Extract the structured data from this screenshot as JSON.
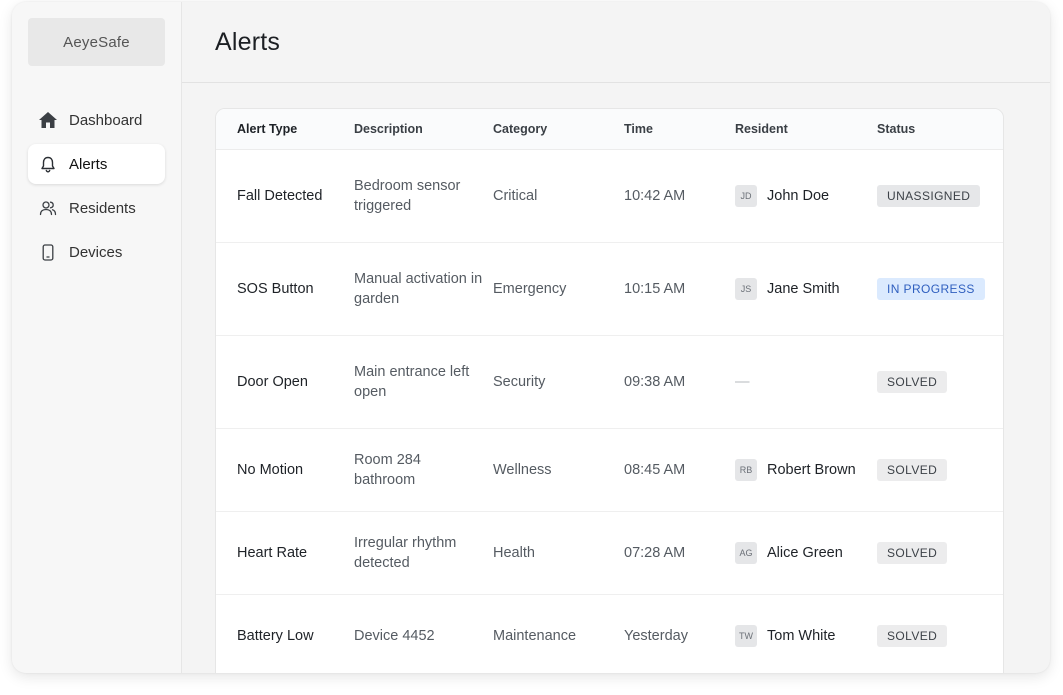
{
  "app": {
    "logo": "AeyeSafe"
  },
  "sidebar": {
    "items": [
      {
        "label": "Dashboard",
        "icon": "home-icon",
        "active": false
      },
      {
        "label": "Alerts",
        "icon": "bell-icon",
        "active": true
      },
      {
        "label": "Residents",
        "icon": "users-icon",
        "active": false
      },
      {
        "label": "Devices",
        "icon": "phone-icon",
        "active": false
      }
    ]
  },
  "header": {
    "title": "Alerts"
  },
  "table": {
    "columns": [
      "Alert Type",
      "Description",
      "Category",
      "Time",
      "Resident",
      "Status"
    ],
    "rows": [
      {
        "type": "Fall Detected",
        "description": "Bedroom sensor triggered",
        "category": "Critical",
        "time": "10:42 AM",
        "resident_initials": "JD",
        "resident": "John Doe",
        "status": "UNASSIGNED"
      },
      {
        "type": "SOS Button",
        "description": "Manual activation in garden",
        "category": "Emergency",
        "time": "10:15 AM",
        "resident_initials": "JS",
        "resident": "Jane Smith",
        "status": "IN PROGRESS"
      },
      {
        "type": "Door Open",
        "description": "Main entrance left open",
        "category": "Security",
        "time": "09:38 AM",
        "resident_initials": "",
        "resident": "—",
        "status": "SOLVED"
      },
      {
        "type": "No Motion",
        "description": "Room 284 bathroom",
        "category": "Wellness",
        "time": "08:45 AM",
        "resident_initials": "RB",
        "resident": "Robert Brown",
        "status": "SOLVED"
      },
      {
        "type": "Heart Rate",
        "description": "Irregular rhythm detected",
        "category": "Health",
        "time": "07:28 AM",
        "resident_initials": "AG",
        "resident": "Alice Green",
        "status": "SOLVED"
      },
      {
        "type": "Battery Low",
        "description": "Device 4452",
        "category": "Maintenance",
        "time": "Yesterday",
        "resident_initials": "TW",
        "resident": "Tom White",
        "status": "SOLVED"
      }
    ]
  },
  "colors": {
    "in_progress_bg": "#dbeafe",
    "in_progress_text": "#2f5fbf",
    "badge_bg": "#ececed"
  }
}
